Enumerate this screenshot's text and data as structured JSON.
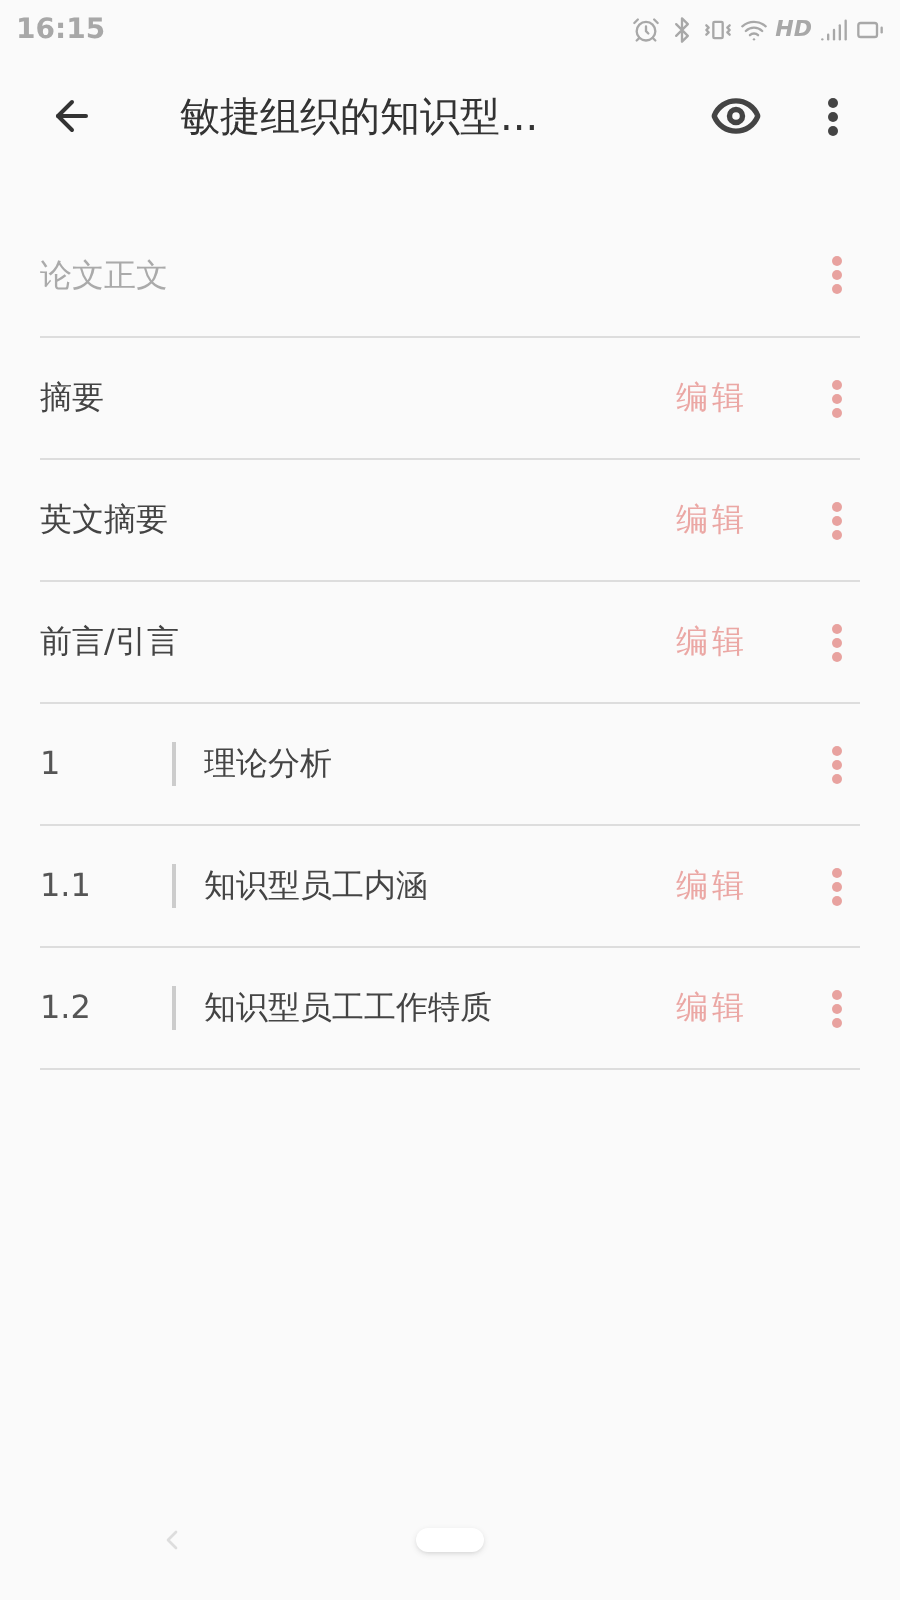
{
  "status_bar": {
    "time": "16:15",
    "network": "HD"
  },
  "app_bar": {
    "title": "敏捷组织的知识型..."
  },
  "rows": [
    {
      "kind": "section",
      "title": "论文正文"
    },
    {
      "kind": "item",
      "title": "摘要",
      "action": "编辑"
    },
    {
      "kind": "item",
      "title": "英文摘要",
      "action": "编辑"
    },
    {
      "kind": "item",
      "title": "前言/引言",
      "action": "编辑"
    },
    {
      "kind": "chapter",
      "number": "1",
      "title": "理论分析"
    },
    {
      "kind": "chapter",
      "number": "1.1",
      "title": "知识型员工内涵",
      "action": "编辑"
    },
    {
      "kind": "chapter",
      "number": "1.2",
      "title": "知识型员工工作特质",
      "action": "编辑"
    }
  ]
}
